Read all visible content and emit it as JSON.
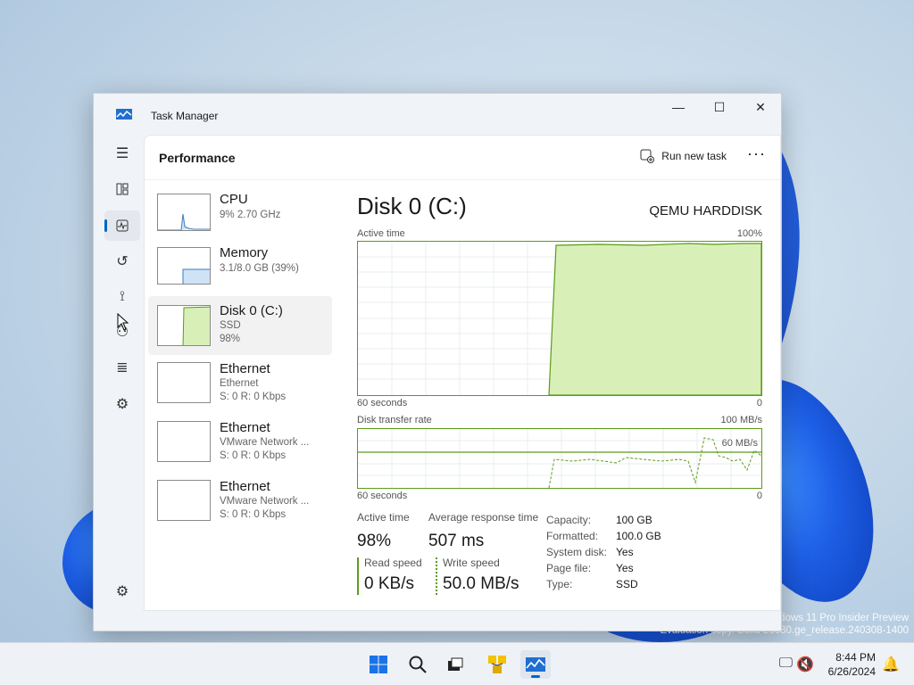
{
  "window": {
    "title": "Task Manager",
    "minimize_label": "—",
    "maximize_label": "☐",
    "close_label": "✕"
  },
  "header": {
    "page_title": "Performance",
    "run_new_task": "Run new task",
    "more_label": "···"
  },
  "resources": [
    {
      "name": "CPU",
      "sub1": "9%  2.70 GHz",
      "sub2": ""
    },
    {
      "name": "Memory",
      "sub1": "3.1/8.0 GB (39%)",
      "sub2": ""
    },
    {
      "name": "Disk 0 (C:)",
      "sub1": "SSD",
      "sub2": "98%"
    },
    {
      "name": "Ethernet",
      "sub1": "Ethernet",
      "sub2": "S: 0  R: 0 Kbps"
    },
    {
      "name": "Ethernet",
      "sub1": "VMware Network ...",
      "sub2": "S: 0  R: 0 Kbps"
    },
    {
      "name": "Ethernet",
      "sub1": "VMware Network ...",
      "sub2": "S: 0  R: 0 Kbps"
    }
  ],
  "disk": {
    "title": "Disk 0 (C:)",
    "model": "QEMU HARDDISK",
    "active_time_label": "Active time",
    "active_time_max": "100%",
    "seconds_label": "60 seconds",
    "zero": "0",
    "transfer_label": "Disk transfer rate",
    "transfer_max": "100 MB/s",
    "transfer_mark": "60 MB/s",
    "active_percent": 98,
    "stats": {
      "active_time_label": "Active time",
      "active_time_value": "98%",
      "avg_response_label": "Average response time",
      "avg_response_value": "507 ms",
      "read_label": "Read speed",
      "read_value": "0 KB/s",
      "write_label": "Write speed",
      "write_value": "50.0 MB/s"
    },
    "props": [
      {
        "k": "Capacity:",
        "v": "100 GB"
      },
      {
        "k": "Formatted:",
        "v": "100.0 GB"
      },
      {
        "k": "System disk:",
        "v": "Yes"
      },
      {
        "k": "Page file:",
        "v": "Yes"
      },
      {
        "k": "Type:",
        "v": "SSD"
      }
    ]
  },
  "taskbar": {
    "time": "8:44 PM",
    "date": "6/26/2024"
  },
  "watermark": {
    "line1": "Windows 11 Pro Insider Preview",
    "line2": "Evaluation copy. Build 26080.ge_release.240308-1400"
  },
  "colors": {
    "accent": "#0067c0",
    "disk_green": "#5b9b19",
    "disk_fill": "#d8f0b8",
    "memory_fill": "#cfe3f7"
  }
}
